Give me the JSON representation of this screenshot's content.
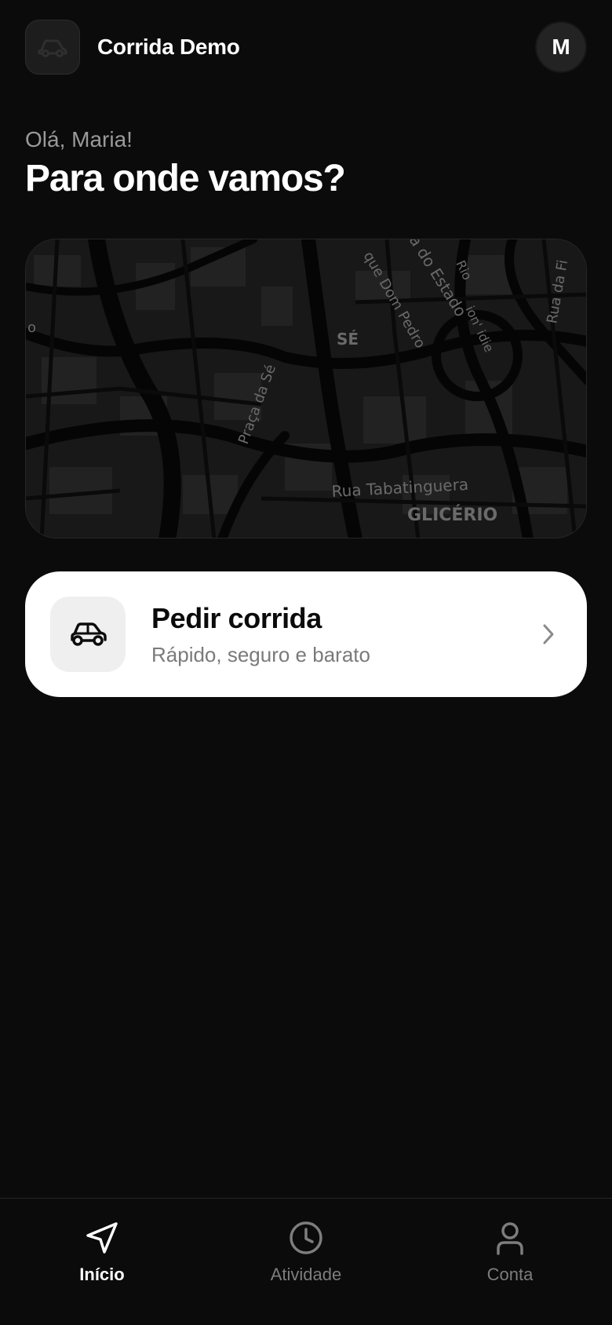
{
  "header": {
    "app_title": "Corrida Demo",
    "avatar_initial": "M",
    "logo_icon": "car-icon"
  },
  "home": {
    "greeting": "Olá, Maria!",
    "headline": "Para onde vamos?"
  },
  "map": {
    "labels": {
      "se": "SÉ",
      "praca_da_se": "Praça da Sé",
      "dom_pedro": "que Dom Pedro",
      "do_estado": "a do Estado",
      "rio": "Rio",
      "rio_tail": "ion' idie",
      "rua_da": "Rua da Fi",
      "tabatinguera": "Rua Tabatinguera",
      "glicerio": "GLICÉRIO",
      "left_edge": "o"
    }
  },
  "ride_card": {
    "title": "Pedir corrida",
    "subtitle": "Rápido, seguro e barato",
    "icon": "car-icon",
    "action_icon": "chevron-right-icon"
  },
  "bottom_nav": {
    "items": [
      {
        "label": "Início",
        "icon": "navigation-arrow-icon",
        "active": true
      },
      {
        "label": "Atividade",
        "icon": "clock-icon",
        "active": false
      },
      {
        "label": "Conta",
        "icon": "user-icon",
        "active": false
      }
    ]
  },
  "colors": {
    "background": "#0b0b0b",
    "card": "#ffffff",
    "muted_text": "#9a9a9a",
    "map_bg": "#181818"
  }
}
